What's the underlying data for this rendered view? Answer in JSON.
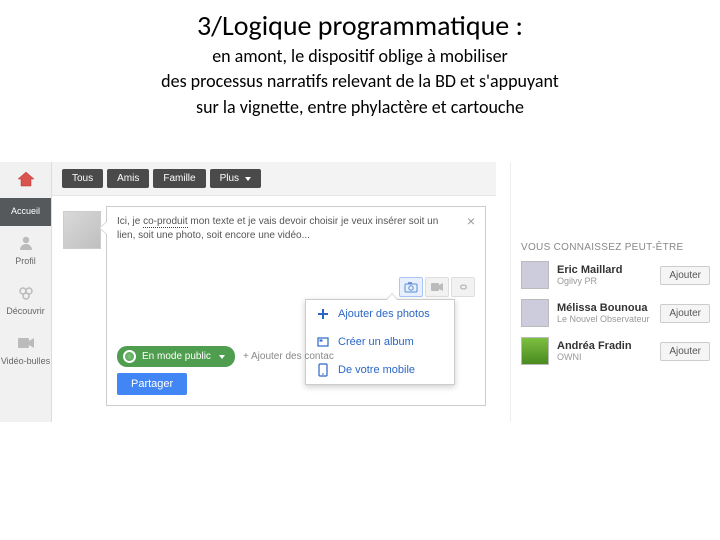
{
  "slide": {
    "title": "3/Logique programmatique :",
    "sub1": "en amont, le dispositif oblige à mobiliser",
    "sub2": "des processus narratifs relevant de la BD et s'appuyant",
    "sub3": "sur la vignette, entre phylactère et cartouche"
  },
  "sidebar": {
    "items": [
      {
        "label": "Accueil"
      },
      {
        "label": "Profil"
      },
      {
        "label": "Découvrir"
      },
      {
        "label": "Vidéo-bulles"
      }
    ]
  },
  "tabs": {
    "items": [
      {
        "label": "Tous"
      },
      {
        "label": "Amis"
      },
      {
        "label": "Famille"
      },
      {
        "label": "Plus"
      }
    ]
  },
  "composer": {
    "text_prefix": "Ici, je ",
    "text_squiggle": "co-produit",
    "text_rest": " mon texte et je vais devoir choisir je veux insérer soit un lien, soit une photo, soit encore une vidéo...",
    "visibility_label": "En mode public",
    "add_contacts": "+ Ajouter des contac",
    "share_label": "Partager"
  },
  "photo_menu": {
    "items": [
      {
        "icon": "+",
        "label": "Ajouter des photos"
      },
      {
        "icon": "album",
        "label": "Créer un album"
      },
      {
        "icon": "mobile",
        "label": "De votre mobile"
      }
    ]
  },
  "rightcol": {
    "title": "VOUS CONNAISSEZ PEUT-ÊTRE",
    "people": [
      {
        "name": "Eric Maillard",
        "org": "Ogilvy PR"
      },
      {
        "name": "Mélissa Bounoua",
        "org": "Le Nouvel Observateur"
      },
      {
        "name": "Andréa Fradin",
        "org": "OWNI"
      }
    ],
    "add_label": "Ajouter"
  }
}
